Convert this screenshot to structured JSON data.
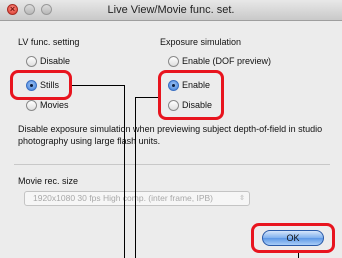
{
  "window": {
    "title": "Live View/Movie func. set.",
    "close_glyph": "×"
  },
  "lv_func": {
    "label": "LV func. setting",
    "options": [
      {
        "label": "Disable",
        "selected": false
      },
      {
        "label": "Stills",
        "selected": true
      },
      {
        "label": "Movies",
        "selected": false
      }
    ]
  },
  "exposure_sim": {
    "label": "Exposure simulation",
    "options": [
      {
        "label": "Enable (DOF preview)",
        "selected": false
      },
      {
        "label": "Enable",
        "selected": true
      },
      {
        "label": "Disable",
        "selected": false
      }
    ]
  },
  "description": "Disable exposure simulation when previewing subject depth-of-field in studio photography using large flash units.",
  "movie_size": {
    "label": "Movie rec. size",
    "value": "1920x1080 30 fps High comp. (inter frame, IPB)",
    "arrows": "⇳"
  },
  "buttons": {
    "ok": "OK"
  },
  "colors": {
    "highlight": "#e8141e",
    "radio_selected": "#3f7fd8"
  }
}
